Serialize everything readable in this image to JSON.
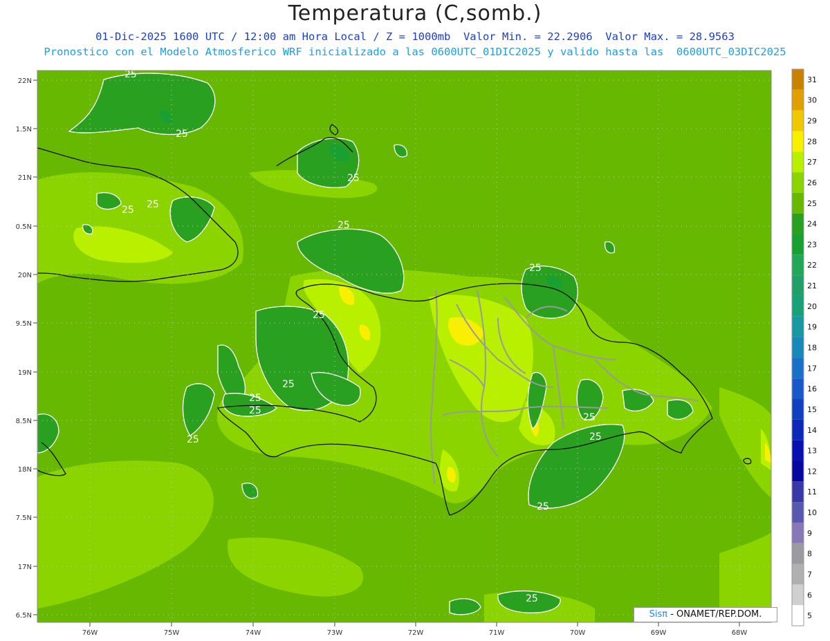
{
  "title": "Temperatura (C,somb.)",
  "subtitle_line1": "01-Dic-2025 1600 UTC / 12:00 am Hora Local / Z = 1000mb  Valor Min. = 22.2906  Valor Max. = 28.9563",
  "subtitle_line2": "Pronostico con el Modelo Atmosferico WRF inicializado a las 0600UTC_01DIC2025 y valido hasta las  0600UTC_03DIC2025",
  "credit": {
    "brand": "Sisπ",
    "rest": " - ONAMET/REP.DOM."
  },
  "axes": {
    "lon_ticks": [
      "76W",
      "75W",
      "74W",
      "73W",
      "72W",
      "71W",
      "70W",
      "69W",
      "68W"
    ],
    "lat_ticks": [
      "22N",
      "1.5N",
      "21N",
      "0.5N",
      "20N",
      "9.5N",
      "19N",
      "8.5N",
      "18N",
      "7.5N",
      "17N",
      "6.5N"
    ]
  },
  "contour_labels": [
    "25",
    "25",
    "25",
    "25",
    "25",
    "25",
    "25",
    "25",
    "25",
    "25",
    "25",
    "25",
    "25",
    "25",
    "25",
    "25"
  ],
  "colorbar": {
    "levels": [
      "31",
      "30",
      "29",
      "28",
      "27",
      "26",
      "25",
      "24",
      "23",
      "22",
      "21",
      "20",
      "19",
      "18",
      "17",
      "16",
      "15",
      "14",
      "13",
      "12",
      "11",
      "10",
      "9",
      "8",
      "7",
      "6",
      "5"
    ],
    "colors": [
      "#c88200",
      "#e0a000",
      "#f0c800",
      "#f8f000",
      "#b8f000",
      "#8cd400",
      "#66b800",
      "#2aa020",
      "#18a030",
      "#20a858",
      "#20a068",
      "#18a078",
      "#1898a0",
      "#1888b8",
      "#1870c8",
      "#1858c8",
      "#1040c0",
      "#0c28b8",
      "#0810b0",
      "#0808a0",
      "#3838a8",
      "#5858b0",
      "#8878b8",
      "#9a9aa0",
      "#b0b0b0",
      "#d0d0d0",
      "#ffffff"
    ]
  }
}
